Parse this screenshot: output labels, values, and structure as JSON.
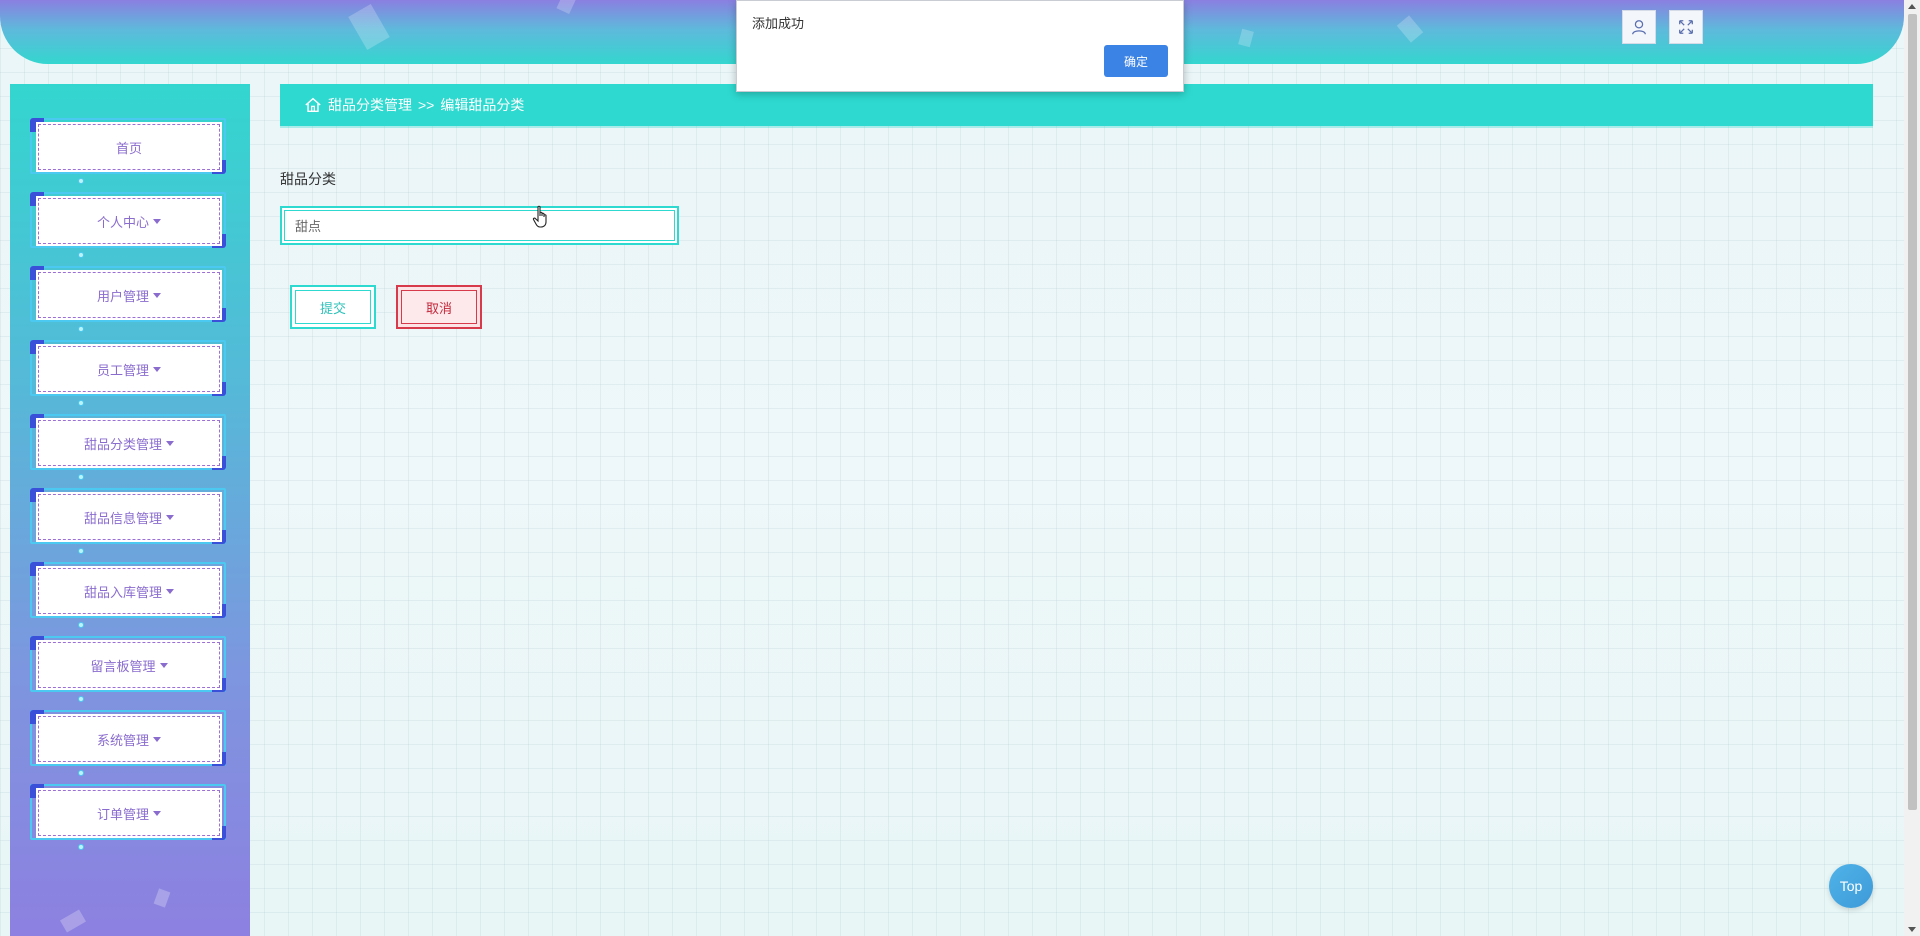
{
  "alert": {
    "message": "添加成功",
    "ok_label": "确定"
  },
  "header": {
    "user_icon": "user-icon",
    "fullscreen_icon": "fullscreen-icon"
  },
  "sidebar": {
    "items": [
      {
        "label": "首页",
        "has_caret": false
      },
      {
        "label": "个人中心",
        "has_caret": true
      },
      {
        "label": "用户管理",
        "has_caret": true
      },
      {
        "label": "员工管理",
        "has_caret": true
      },
      {
        "label": "甜品分类管理",
        "has_caret": true
      },
      {
        "label": "甜品信息管理",
        "has_caret": true
      },
      {
        "label": "甜品入库管理",
        "has_caret": true
      },
      {
        "label": "留言板管理",
        "has_caret": true
      },
      {
        "label": "系统管理",
        "has_caret": true
      },
      {
        "label": "订单管理",
        "has_caret": true
      }
    ]
  },
  "breadcrumb": {
    "home_icon": "home-icon",
    "parent": "甜品分类管理",
    "separator": ">>",
    "current": "编辑甜品分类"
  },
  "form": {
    "field_label": "甜品分类",
    "field_value": "甜点",
    "submit_label": "提交",
    "cancel_label": "取消"
  },
  "top_button": {
    "label": "Top"
  },
  "colors": {
    "accent_teal": "#2ed9cf",
    "header_purple": "#8a7fe0",
    "cancel_red": "#d73a4a",
    "ok_blue": "#3c83e6",
    "menu_text": "#8a6ccf"
  }
}
